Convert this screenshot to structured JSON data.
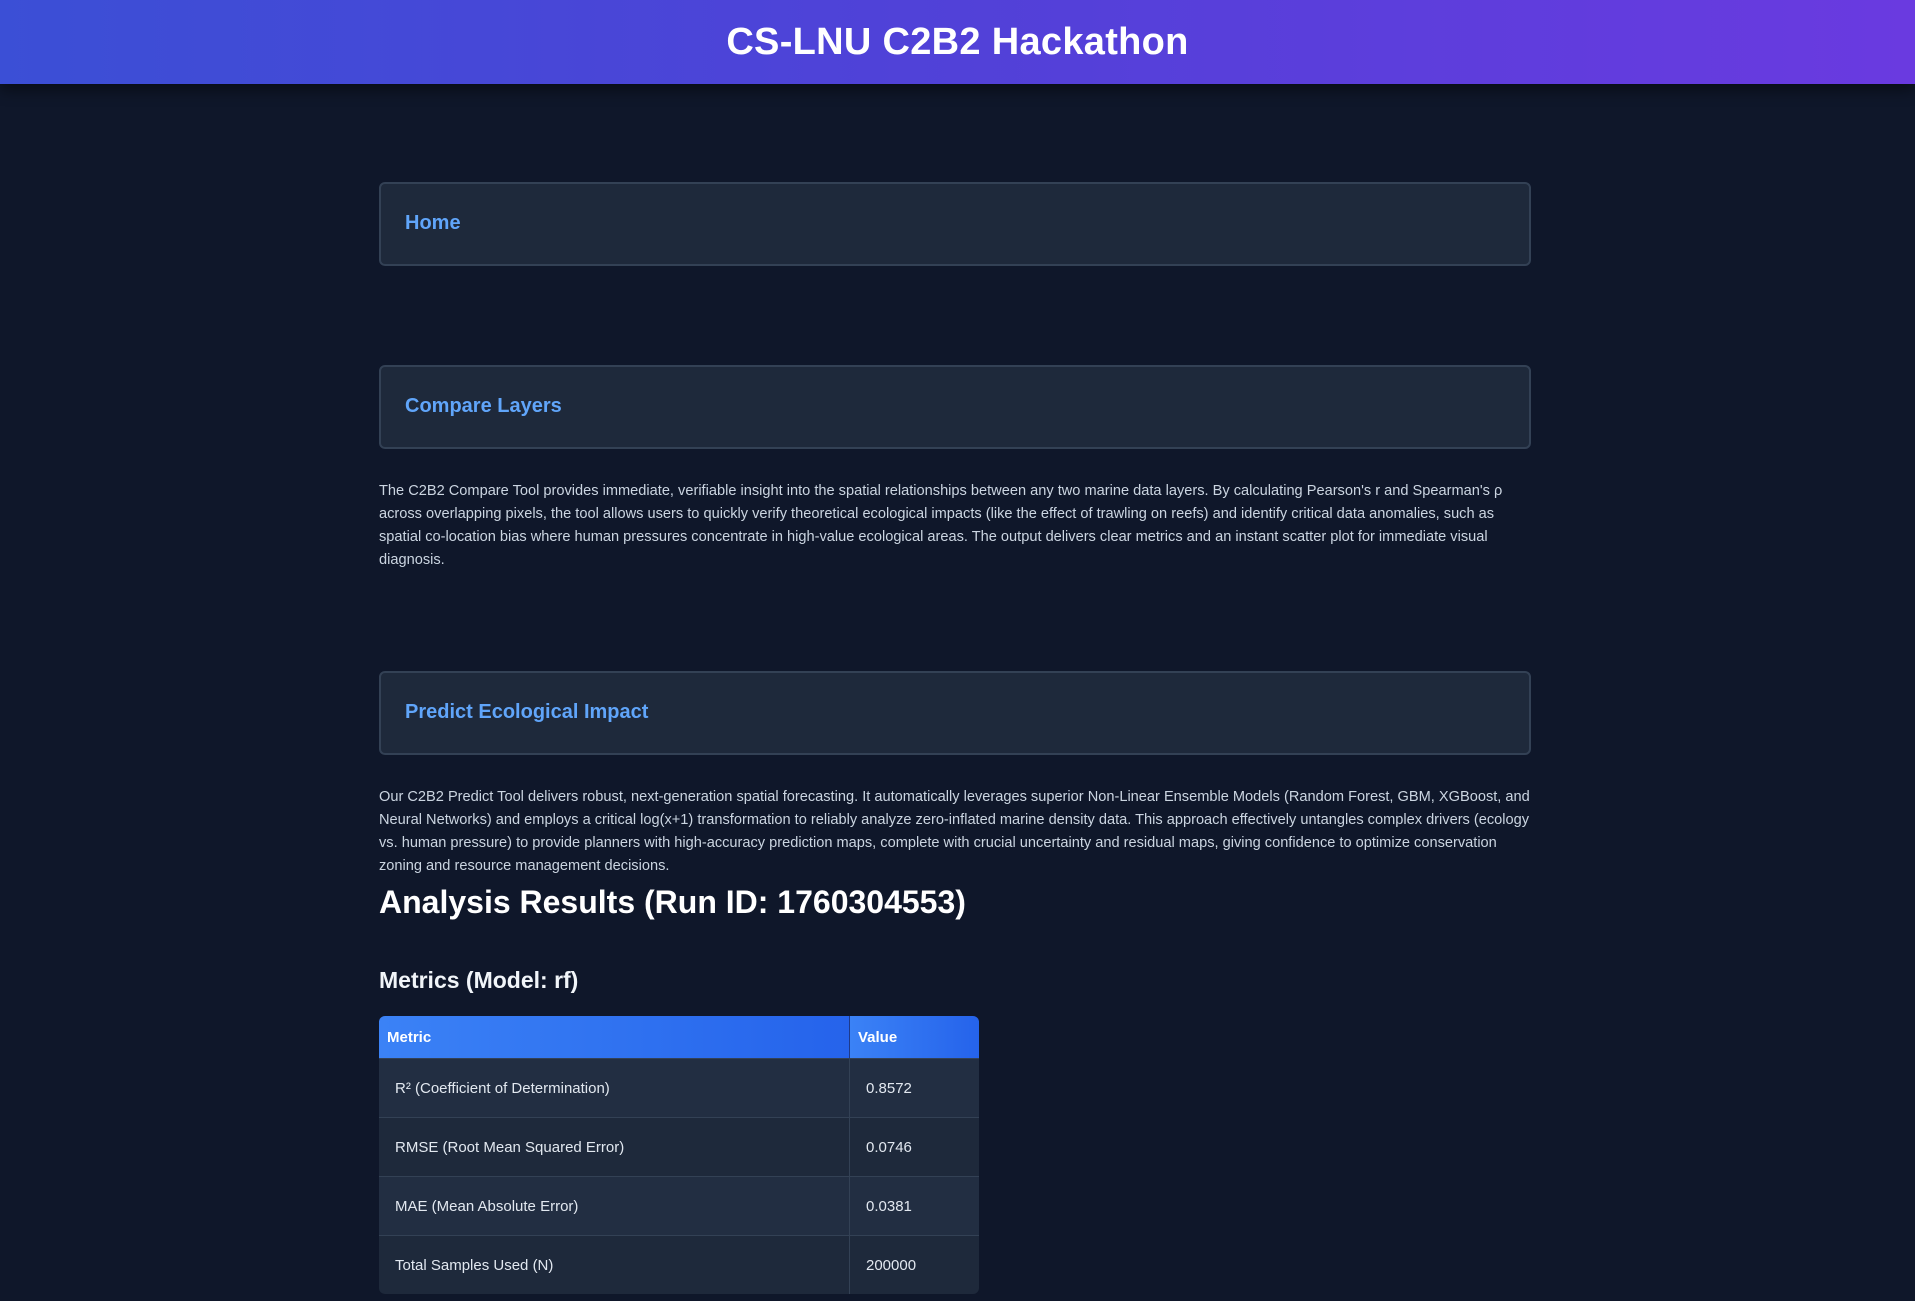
{
  "header": {
    "title": "CS-LNU C2B2 Hackathon"
  },
  "sections": {
    "home": {
      "title": "Home"
    },
    "compare": {
      "title": "Compare Layers",
      "description": "The C2B2 Compare Tool provides immediate, verifiable insight into the spatial relationships between any two marine data layers. By calculating Pearson's r and Spearman's ρ across overlapping pixels, the tool allows users to quickly verify theoretical ecological impacts (like the effect of trawling on reefs) and identify critical data anomalies, such as spatial co-location bias where human pressures concentrate in high-value ecological areas. The output delivers clear metrics and an instant scatter plot for immediate visual diagnosis."
    },
    "predict": {
      "title": "Predict Ecological Impact",
      "description": "Our C2B2 Predict Tool delivers robust, next-generation spatial forecasting. It automatically leverages superior Non-Linear Ensemble Models (Random Forest, GBM, XGBoost, and Neural Networks) and employs a critical log(x+1) transformation to reliably analyze zero-inflated marine density data. This approach effectively untangles complex drivers (ecology vs. human pressure) to provide planners with high-accuracy prediction maps, complete with crucial uncertainty and residual maps, giving confidence to optimize conservation zoning and resource management decisions."
    }
  },
  "results": {
    "title": "Analysis Results (Run ID: 1760304553)",
    "metrics_title": "Metrics (Model: rf)",
    "table": {
      "headers": [
        "Metric",
        "Value"
      ],
      "rows": [
        {
          "metric": "R² (Coefficient of Determination)",
          "value": "0.8572"
        },
        {
          "metric": "RMSE (Root Mean Squared Error)",
          "value": "0.0746"
        },
        {
          "metric": "MAE (Mean Absolute Error)",
          "value": "0.0381"
        },
        {
          "metric": "Total Samples Used (N)",
          "value": "200000"
        }
      ]
    }
  },
  "colors": {
    "background": "#0f172a",
    "card": "#1e293b",
    "accent_link": "#60a5fa",
    "header_gradient_start": "#3b4fd6",
    "header_gradient_end": "#6a3ae0",
    "table_header": "#3b82f6"
  }
}
